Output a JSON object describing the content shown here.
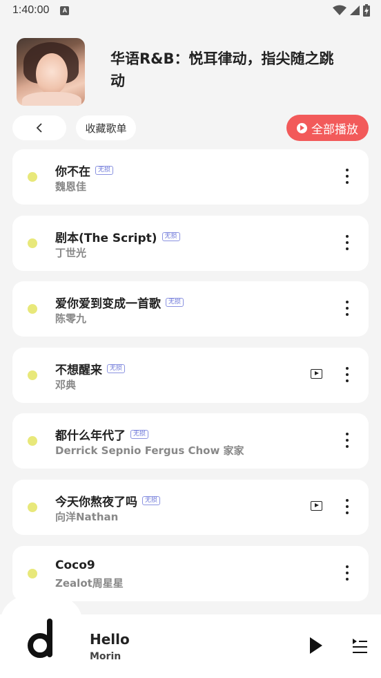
{
  "status_bar": {
    "time": "1:40:00",
    "notification_badge": "A"
  },
  "playlist": {
    "title": "华语R&B：悦耳律动，指尖随之跳动"
  },
  "actions": {
    "favorite_label": "收藏歌单",
    "play_all_label": "全部播放"
  },
  "songs": [
    {
      "title": "你不在",
      "badge": "无损",
      "artist": "魏恩佳",
      "has_mv": false
    },
    {
      "title": "剧本(The Script)",
      "badge": "无损",
      "artist": "丁世光",
      "has_mv": false
    },
    {
      "title": "爱你爱到变成一首歌",
      "badge": "无损",
      "artist": "陈零九",
      "has_mv": false
    },
    {
      "title": "不想醒来",
      "badge": "无损",
      "artist": "邓典",
      "has_mv": true
    },
    {
      "title": "都什么年代了",
      "badge": "无损",
      "artist": "Derrick Sepnio Fergus Chow 家家",
      "has_mv": false
    },
    {
      "title": "今天你熬夜了吗",
      "badge": "无损",
      "artist": "向洋Nathan",
      "has_mv": true
    },
    {
      "title": "Coco9",
      "badge": "",
      "artist": "Zealot周星星",
      "has_mv": false
    }
  ],
  "now_playing": {
    "title": "Hello",
    "artist": "Morin"
  },
  "colors": {
    "accent": "#f25a5a",
    "dot": "#e8e87a",
    "badge": "#6a74d8",
    "background": "#f4f4f4"
  }
}
